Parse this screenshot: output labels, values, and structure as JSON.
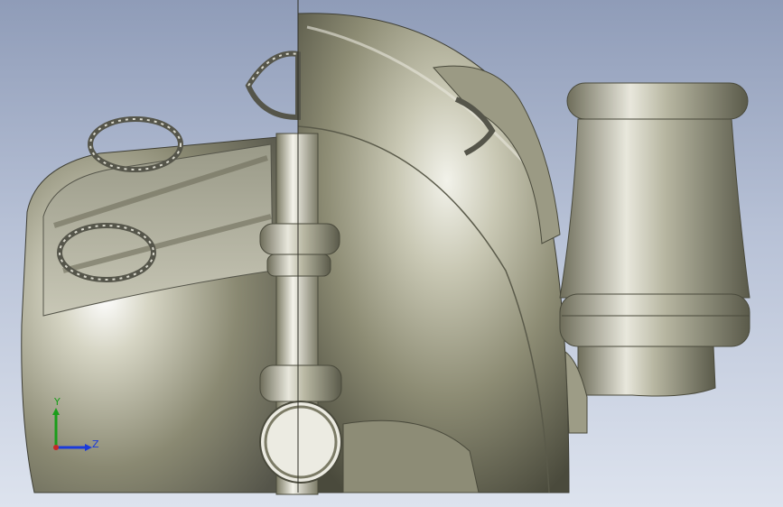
{
  "viewport": {
    "background_top": "#8f9cb8",
    "background_bottom": "#dde3ee",
    "model_color": "#a8a690"
  },
  "triad": {
    "y_label": "Y",
    "z_label": "Z",
    "y_color": "#1a9d1a",
    "z_color": "#1a3adb",
    "x_color": "#c62828"
  }
}
